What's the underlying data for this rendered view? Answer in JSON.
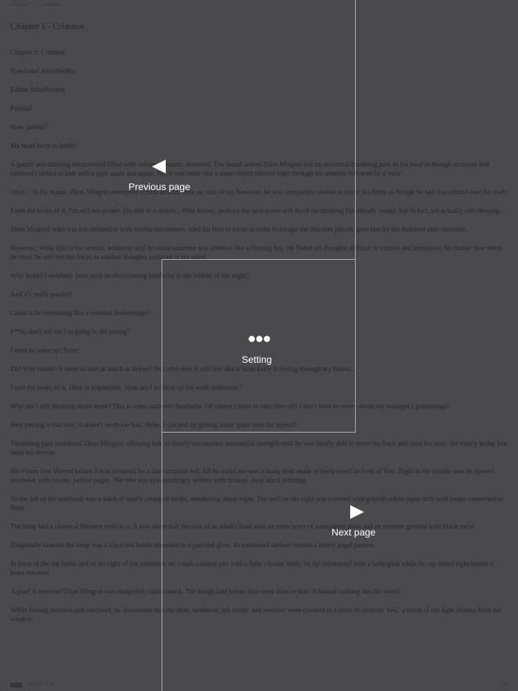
{
  "header": {
    "chapter_label": "Chapter 1 - Crimson"
  },
  "chapter": {
    "title": "Chapter 1 - Crimson"
  },
  "content": {
    "paragraphs": [
      "Chapter 1: Crimson",
      "Translator:AtlasStudios",
      "Editor:AtlasStudios",
      "Painful!",
      "How painful!",
      "My head hurts so badly!",
      "A gaudy and dazzling dreamworld filled with colours instantly shattered. The sound asleep Zhou Mingrui felt an abnormal throbbing pain in his head as though someone had ruthlessly lashed at him with a pole again and again. No, it was more like a sharp object pierced right through his temples followed by a twist!",
      "Ouch... In his stupor, Zhou Mingrui attempted to turn around, look up, and sit up; however, he was completely unable to move his limbs as though he had lost control over his body.",
      "From the looks of it, I'm still not awake. I'm still in a dream... Who knows, perhaps the next scene will be of me thinking I'm already awake, but in fact, am actually still sleeping...",
      "Zhou Mingrui, who was not unfamiliar with similar encounters, tried his best to focus in order to escape the shackles placed upon him by the darkness and confusion.",
      "However, while still in his reverie, whatever will he could summon was ethereal like a fleeting fog. He found his thoughts difficult to control and introspect. No matter how much he tried, he still lost his focus as random thoughts surfaced in his mind.",
      "Why would I suddenly have such an excruciating headache in the middle of the night?",
      "And it's really painful!",
      "Could it be something like a cerebral hemorrhage?",
      "F**k, don't tell me I'm going to die young?",
      "I need to wake up! Now!",
      "Eh? Why doesn't it seem to hurt as much as before? But why does it still feel like a blunt knife is slicing through my brains...",
      "From the looks of it, sleep is impossible. How am I to show up for work tomorrow?",
      "Why am I still thinking about work? This is some authentic headache. Of course I have to take time off! I don't have to worry about my manager's grumblings!",
      "Hey, putting it that way, it doesn't seem too bad. Hehe, I can end up getting some spare time for myself!",
      "Throbbing pain inundated Zhou Mingrui, allowing him to slowly accumulate immaterial strength until he was finally able to move his back and open his eyes. He finally broke free from his reverie.",
      "His vision first blurred before it was screened by a faint crimson red. All he could see was a study desk made of burly wood in front of him. Right in the middle was an opened notebook with coarse, yellow pages. The title was eye-catchingly written with strange, deep black lettering.",
      "To the left of the notebook was a stack of neatly arranged books, numbering about eight. The wall on the right was covered with grayish-white pipes with wall lamps connected to them.",
      "The lamp had a classical Western style to it. It was about half the size of an adult's head with an inner layer of transparent glass and an exterior gridded with black metal.",
      "Diagonally beneath the lamp was a black ink bottle shrouded in a pale red glow. Its embossed surface formed a blurry angel pattern.",
      "In front of the ink bottle and to the right of the notebook sat a dark-colored pen with a fully circular body. Its tip shimmered with a faint glint while its cap rested right beside a brass revolver.",
      "A gun? A revolver?Zhou Mingrui was completely taken aback. The things laid before him were alien to him. It looked nothing like his room!",
      "While feeling shocked and confused, he discovered that the desk, notebook, ink bottle, and revolver were covered in a layer of crimson 'veil,' a result of the light shining from the window."
    ]
  },
  "footer": {
    "time": "09:07 PM",
    "page": "1/2"
  },
  "overlay": {
    "prev_label": "Previous page",
    "settings_label": "Setting",
    "next_label": "Next page",
    "icons": {
      "prev": "triangle-left-icon",
      "settings": "ellipsis-icon",
      "next": "triangle-right-icon"
    },
    "colors": {
      "dim_background": "#4a4a4c",
      "overlay_text": "#ffffff",
      "divider": "#b8b8ba"
    }
  }
}
